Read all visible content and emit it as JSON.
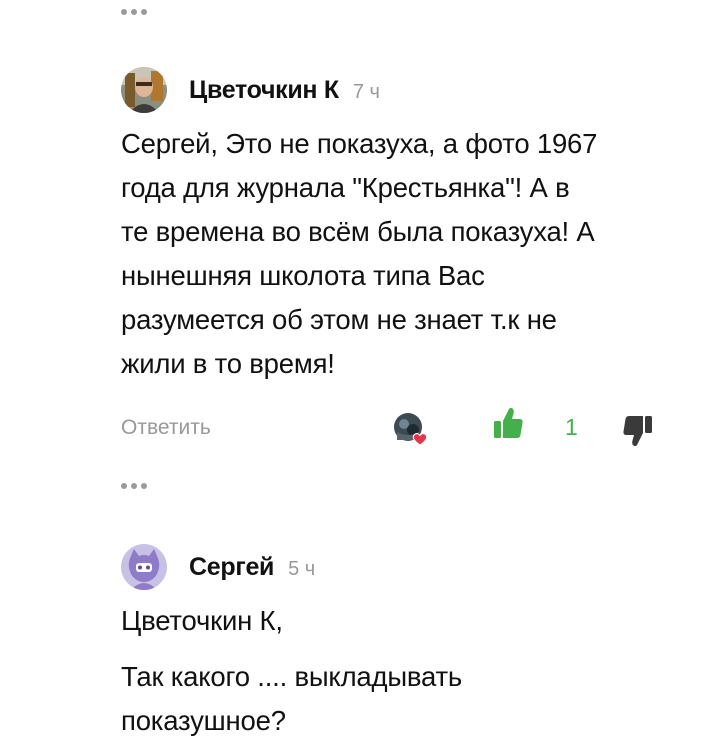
{
  "comments": [
    {
      "author": "Цветочкин К",
      "time": "7 ч",
      "text_lines": [
        "Сергей, Это не показуха, а фото 1967",
        "года для журнала \"Крестьянка\"! А в",
        "те времена во всём была показуха! А",
        "нынешняя школота типа Вас",
        "разумеется об этом не знает т.к не",
        "жили в то время!"
      ],
      "reply_label": "Ответить",
      "likes": "1"
    },
    {
      "author": "Сергей",
      "time": "5 ч",
      "paragraphs": [
        "Цветочкин К,",
        "Так какого .... выкладывать",
        "показушное?"
      ]
    }
  ],
  "colors": {
    "like_green": "#44b04a",
    "muted_gray": "#999999",
    "dislike_gray": "#3a3a3a",
    "heart_red": "#e5354a",
    "cat_avatar_bg": "#c9c0e6"
  },
  "icons": {
    "more": "more-dots-icon",
    "like": "thumbs-up-icon",
    "dislike": "thumbs-down-icon",
    "heart": "heart-icon"
  }
}
